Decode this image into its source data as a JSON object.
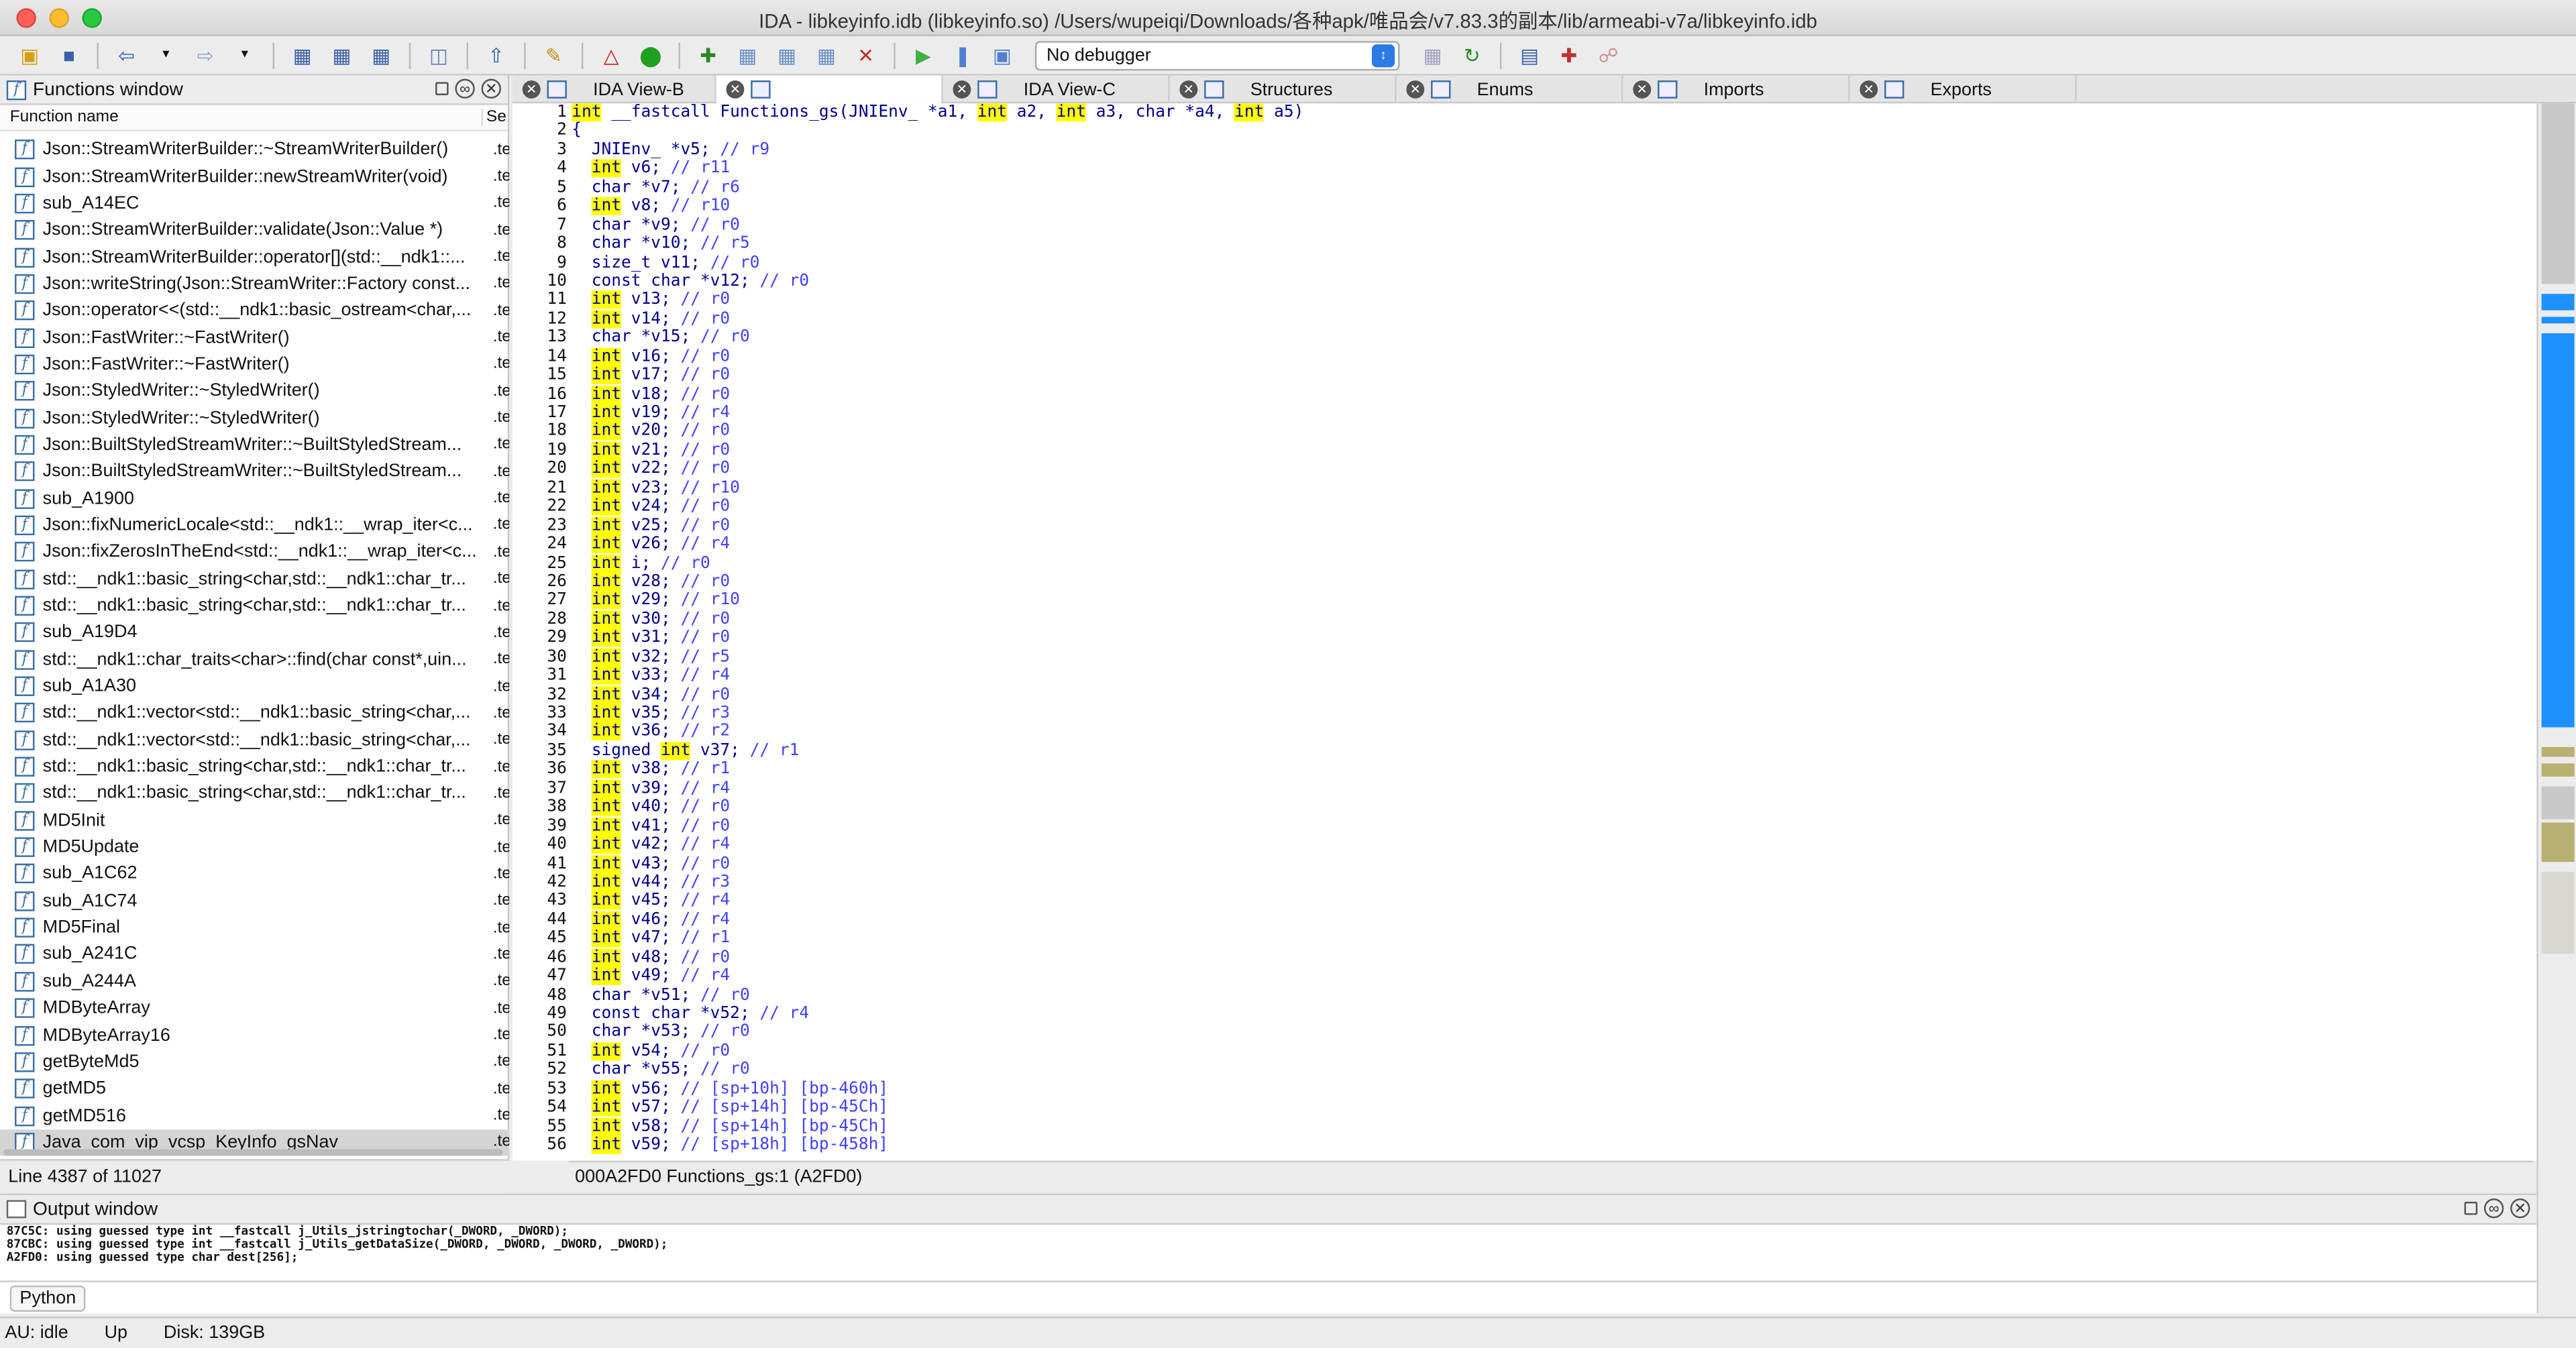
{
  "window": {
    "title": "IDA - libkeyinfo.idb (libkeyinfo.so) /Users/wupeiqi/Downloads/各种apk/唯品会/v7.83.3的副本/lib/armeabi-v7a/libkeyinfo.idb"
  },
  "toolbar": {
    "debugger_select": "No debugger"
  },
  "functions_window": {
    "title": "Functions window",
    "col_name": "Function name",
    "col_segment": "Se",
    "status": "Line 4387 of 11027",
    "items": [
      {
        "name": "Json::StreamWriterBuilder::~StreamWriterBuilder()",
        "seg": ".te"
      },
      {
        "name": "Json::StreamWriterBuilder::newStreamWriter(void)",
        "seg": ".te"
      },
      {
        "name": "sub_A14EC",
        "seg": ".te"
      },
      {
        "name": "Json::StreamWriterBuilder::validate(Json::Value *)",
        "seg": ".te"
      },
      {
        "name": "Json::StreamWriterBuilder::operator[](std::__ndk1::...",
        "seg": ".te"
      },
      {
        "name": "Json::writeString(Json::StreamWriter::Factory const...",
        "seg": ".te"
      },
      {
        "name": "Json::operator<<(std::__ndk1::basic_ostream<char,...",
        "seg": ".te"
      },
      {
        "name": "Json::FastWriter::~FastWriter()",
        "seg": ".te"
      },
      {
        "name": "Json::FastWriter::~FastWriter()",
        "seg": ".te"
      },
      {
        "name": "Json::StyledWriter::~StyledWriter()",
        "seg": ".te"
      },
      {
        "name": "Json::StyledWriter::~StyledWriter()",
        "seg": ".te"
      },
      {
        "name": "Json::BuiltStyledStreamWriter::~BuiltStyledStream...",
        "seg": ".te"
      },
      {
        "name": "Json::BuiltStyledStreamWriter::~BuiltStyledStream...",
        "seg": ".te"
      },
      {
        "name": "sub_A1900",
        "seg": ".te"
      },
      {
        "name": "Json::fixNumericLocale<std::__ndk1::__wrap_iter<c...",
        "seg": ".te"
      },
      {
        "name": "Json::fixZerosInTheEnd<std::__ndk1::__wrap_iter<c...",
        "seg": ".te"
      },
      {
        "name": "std::__ndk1::basic_string<char,std::__ndk1::char_tr...",
        "seg": ".te"
      },
      {
        "name": "std::__ndk1::basic_string<char,std::__ndk1::char_tr...",
        "seg": ".te"
      },
      {
        "name": "sub_A19D4",
        "seg": ".te"
      },
      {
        "name": "std::__ndk1::char_traits<char>::find(char const*,uin...",
        "seg": ".te"
      },
      {
        "name": "sub_A1A30",
        "seg": ".te"
      },
      {
        "name": "std::__ndk1::vector<std::__ndk1::basic_string<char,...",
        "seg": ".te"
      },
      {
        "name": "std::__ndk1::vector<std::__ndk1::basic_string<char,...",
        "seg": ".te"
      },
      {
        "name": "std::__ndk1::basic_string<char,std::__ndk1::char_tr...",
        "seg": ".te"
      },
      {
        "name": "std::__ndk1::basic_string<char,std::__ndk1::char_tr...",
        "seg": ".te"
      },
      {
        "name": "MD5Init",
        "seg": ".te"
      },
      {
        "name": "MD5Update",
        "seg": ".te"
      },
      {
        "name": "sub_A1C62",
        "seg": ".te"
      },
      {
        "name": "sub_A1C74",
        "seg": ".te"
      },
      {
        "name": "MD5Final",
        "seg": ".te"
      },
      {
        "name": "sub_A241C",
        "seg": ".te"
      },
      {
        "name": "sub_A244A",
        "seg": ".te"
      },
      {
        "name": "MDByteArray",
        "seg": ".te"
      },
      {
        "name": "MDByteArray16",
        "seg": ".te"
      },
      {
        "name": "getByteMd5",
        "seg": ".te"
      },
      {
        "name": "getMD5",
        "seg": ".te"
      },
      {
        "name": "getMD516",
        "seg": ".te"
      },
      {
        "name": "Java_com_vip_vcsp_KeyInfo_gsNav",
        "seg": ".te",
        "selected": true
      }
    ]
  },
  "tabs": [
    {
      "label": "IDA View-B",
      "width": 124
    },
    {
      "label": "",
      "width": 138,
      "active": true
    },
    {
      "label": "IDA View-C",
      "width": 138
    },
    {
      "label": "Structures",
      "width": 138
    },
    {
      "label": "Enums",
      "width": 138
    },
    {
      "label": "Imports",
      "width": 138
    },
    {
      "label": "Exports",
      "width": 138
    }
  ],
  "code": {
    "lines": [
      [
        [
          "hl",
          "int"
        ],
        [
          "t",
          " __fastcall Functions_gs(JNIEnv_ *a1, "
        ],
        [
          "hl",
          "int"
        ],
        [
          "t",
          " a2, "
        ],
        [
          "hl",
          "int"
        ],
        [
          "t",
          " a3, char *a4, "
        ],
        [
          "hl",
          "int"
        ],
        [
          "t",
          " a5)"
        ]
      ],
      [
        [
          "t",
          "{"
        ]
      ],
      [
        [
          "t",
          "  JNIEnv_ *v5; "
        ],
        [
          "c",
          "// r9"
        ]
      ],
      [
        [
          "t",
          "  "
        ],
        [
          "hl",
          "int"
        ],
        [
          "t",
          " v6; "
        ],
        [
          "c",
          "// r11"
        ]
      ],
      [
        [
          "t",
          "  char *v7; "
        ],
        [
          "c",
          "// r6"
        ]
      ],
      [
        [
          "t",
          "  "
        ],
        [
          "hl",
          "int"
        ],
        [
          "t",
          " v8; "
        ],
        [
          "c",
          "// r10"
        ]
      ],
      [
        [
          "t",
          "  char *v9; "
        ],
        [
          "c",
          "// r0"
        ]
      ],
      [
        [
          "t",
          "  char *v10; "
        ],
        [
          "c",
          "// r5"
        ]
      ],
      [
        [
          "t",
          "  size_t v11; "
        ],
        [
          "c",
          "// r0"
        ]
      ],
      [
        [
          "t",
          "  const char *v12; "
        ],
        [
          "c",
          "// r0"
        ]
      ],
      [
        [
          "t",
          "  "
        ],
        [
          "hl",
          "int"
        ],
        [
          "t",
          " v13; "
        ],
        [
          "c",
          "// r0"
        ]
      ],
      [
        [
          "t",
          "  "
        ],
        [
          "hl",
          "int"
        ],
        [
          "t",
          " v14; "
        ],
        [
          "c",
          "// r0"
        ]
      ],
      [
        [
          "t",
          "  char *v15; "
        ],
        [
          "c",
          "// r0"
        ]
      ],
      [
        [
          "t",
          "  "
        ],
        [
          "hl",
          "int"
        ],
        [
          "t",
          " v16; "
        ],
        [
          "c",
          "// r0"
        ]
      ],
      [
        [
          "t",
          "  "
        ],
        [
          "hl",
          "int"
        ],
        [
          "t",
          " v17; "
        ],
        [
          "c",
          "// r0"
        ]
      ],
      [
        [
          "t",
          "  "
        ],
        [
          "hl",
          "int"
        ],
        [
          "t",
          " v18; "
        ],
        [
          "c",
          "// r0"
        ]
      ],
      [
        [
          "t",
          "  "
        ],
        [
          "hl",
          "int"
        ],
        [
          "t",
          " v19; "
        ],
        [
          "c",
          "// r4"
        ]
      ],
      [
        [
          "t",
          "  "
        ],
        [
          "hl",
          "int"
        ],
        [
          "t",
          " v20; "
        ],
        [
          "c",
          "// r0"
        ]
      ],
      [
        [
          "t",
          "  "
        ],
        [
          "hl",
          "int"
        ],
        [
          "t",
          " v21; "
        ],
        [
          "c",
          "// r0"
        ]
      ],
      [
        [
          "t",
          "  "
        ],
        [
          "hl",
          "int"
        ],
        [
          "t",
          " v22; "
        ],
        [
          "c",
          "// r0"
        ]
      ],
      [
        [
          "t",
          "  "
        ],
        [
          "hl",
          "int"
        ],
        [
          "t",
          " v23; "
        ],
        [
          "c",
          "// r10"
        ]
      ],
      [
        [
          "t",
          "  "
        ],
        [
          "hl",
          "int"
        ],
        [
          "t",
          " v24; "
        ],
        [
          "c",
          "// r0"
        ]
      ],
      [
        [
          "t",
          "  "
        ],
        [
          "hl",
          "int"
        ],
        [
          "t",
          " v25; "
        ],
        [
          "c",
          "// r0"
        ]
      ],
      [
        [
          "t",
          "  "
        ],
        [
          "hl",
          "int"
        ],
        [
          "t",
          " v26; "
        ],
        [
          "c",
          "// r4"
        ]
      ],
      [
        [
          "t",
          "  "
        ],
        [
          "hl",
          "int"
        ],
        [
          "t",
          " i; "
        ],
        [
          "c",
          "// r0"
        ]
      ],
      [
        [
          "t",
          "  "
        ],
        [
          "hl",
          "int"
        ],
        [
          "t",
          " v28; "
        ],
        [
          "c",
          "// r0"
        ]
      ],
      [
        [
          "t",
          "  "
        ],
        [
          "hl",
          "int"
        ],
        [
          "t",
          " v29; "
        ],
        [
          "c",
          "// r10"
        ]
      ],
      [
        [
          "t",
          "  "
        ],
        [
          "hl",
          "int"
        ],
        [
          "t",
          " v30; "
        ],
        [
          "c",
          "// r0"
        ]
      ],
      [
        [
          "t",
          "  "
        ],
        [
          "hl",
          "int"
        ],
        [
          "t",
          " v31; "
        ],
        [
          "c",
          "// r0"
        ]
      ],
      [
        [
          "t",
          "  "
        ],
        [
          "hl",
          "int"
        ],
        [
          "t",
          " v32; "
        ],
        [
          "c",
          "// r5"
        ]
      ],
      [
        [
          "t",
          "  "
        ],
        [
          "hl",
          "int"
        ],
        [
          "t",
          " v33; "
        ],
        [
          "c",
          "// r4"
        ]
      ],
      [
        [
          "t",
          "  "
        ],
        [
          "hl",
          "int"
        ],
        [
          "t",
          " v34; "
        ],
        [
          "c",
          "// r0"
        ]
      ],
      [
        [
          "t",
          "  "
        ],
        [
          "hl",
          "int"
        ],
        [
          "t",
          " v35; "
        ],
        [
          "c",
          "// r3"
        ]
      ],
      [
        [
          "t",
          "  "
        ],
        [
          "hl",
          "int"
        ],
        [
          "t",
          " v36; "
        ],
        [
          "c",
          "// r2"
        ]
      ],
      [
        [
          "t",
          "  signed "
        ],
        [
          "hl",
          "int"
        ],
        [
          "t",
          " v37; "
        ],
        [
          "c",
          "// r1"
        ]
      ],
      [
        [
          "t",
          "  "
        ],
        [
          "hl",
          "int"
        ],
        [
          "t",
          " v38; "
        ],
        [
          "c",
          "// r1"
        ]
      ],
      [
        [
          "t",
          "  "
        ],
        [
          "hl",
          "int"
        ],
        [
          "t",
          " v39; "
        ],
        [
          "c",
          "// r4"
        ]
      ],
      [
        [
          "t",
          "  "
        ],
        [
          "hl",
          "int"
        ],
        [
          "t",
          " v40; "
        ],
        [
          "c",
          "// r0"
        ]
      ],
      [
        [
          "t",
          "  "
        ],
        [
          "hl",
          "int"
        ],
        [
          "t",
          " v41; "
        ],
        [
          "c",
          "// r0"
        ]
      ],
      [
        [
          "t",
          "  "
        ],
        [
          "hl",
          "int"
        ],
        [
          "t",
          " v42; "
        ],
        [
          "c",
          "// r4"
        ]
      ],
      [
        [
          "t",
          "  "
        ],
        [
          "hl",
          "int"
        ],
        [
          "t",
          " v43; "
        ],
        [
          "c",
          "// r0"
        ]
      ],
      [
        [
          "t",
          "  "
        ],
        [
          "hl",
          "int"
        ],
        [
          "t",
          " v44; "
        ],
        [
          "c",
          "// r3"
        ]
      ],
      [
        [
          "t",
          "  "
        ],
        [
          "hl",
          "int"
        ],
        [
          "t",
          " v45; "
        ],
        [
          "c",
          "// r4"
        ]
      ],
      [
        [
          "t",
          "  "
        ],
        [
          "hl",
          "int"
        ],
        [
          "t",
          " v46; "
        ],
        [
          "c",
          "// r4"
        ]
      ],
      [
        [
          "t",
          "  "
        ],
        [
          "hl",
          "int"
        ],
        [
          "t",
          " v47; "
        ],
        [
          "c",
          "// r1"
        ]
      ],
      [
        [
          "t",
          "  "
        ],
        [
          "hl",
          "int"
        ],
        [
          "t",
          " v48; "
        ],
        [
          "c",
          "// r0"
        ]
      ],
      [
        [
          "t",
          "  "
        ],
        [
          "hl",
          "int"
        ],
        [
          "t",
          " v49; "
        ],
        [
          "c",
          "// r4"
        ]
      ],
      [
        [
          "t",
          "  char *v51; "
        ],
        [
          "c",
          "// r0"
        ]
      ],
      [
        [
          "t",
          "  const char *v52; "
        ],
        [
          "c",
          "// r4"
        ]
      ],
      [
        [
          "t",
          "  char *v53; "
        ],
        [
          "c",
          "// r0"
        ]
      ],
      [
        [
          "t",
          "  "
        ],
        [
          "hl",
          "int"
        ],
        [
          "t",
          " v54; "
        ],
        [
          "c",
          "// r0"
        ]
      ],
      [
        [
          "t",
          "  char *v55; "
        ],
        [
          "c",
          "// r0"
        ]
      ],
      [
        [
          "t",
          "  "
        ],
        [
          "hl",
          "int"
        ],
        [
          "t",
          " v56; "
        ],
        [
          "c",
          "// [sp+10h] [bp-460h]"
        ]
      ],
      [
        [
          "t",
          "  "
        ],
        [
          "hl",
          "int"
        ],
        [
          "t",
          " v57; "
        ],
        [
          "c",
          "// [sp+14h] [bp-45Ch]"
        ]
      ],
      [
        [
          "t",
          "  "
        ],
        [
          "hl",
          "int"
        ],
        [
          "t",
          " v58; "
        ],
        [
          "c",
          "// [sp+14h] [bp-45Ch]"
        ]
      ],
      [
        [
          "t",
          "  "
        ],
        [
          "hl",
          "int"
        ],
        [
          "t",
          " v59; "
        ],
        [
          "c",
          "// [sp+18h] [bp-458h]"
        ]
      ]
    ],
    "status": "000A2FD0 Functions_gs:1 (A2FD0)"
  },
  "output_window": {
    "title": "Output window",
    "lines": [
      "87C5C: using guessed type int __fastcall j_Utils_jstringtochar(_DWORD, _DWORD);",
      "87CBC: using guessed type int __fastcall j_Utils_getDataSize(_DWORD, _DWORD, _DWORD, _DWORD);",
      "A2FD0: using guessed type char dest[256];"
    ],
    "python_label": "Python"
  },
  "statusbar": {
    "au": "AU:  idle",
    "dir": "Up",
    "disk": "Disk: 139GB"
  },
  "colors": {
    "highlight": "#ffff00",
    "keyword": "#00008b",
    "comment": "#4040ff",
    "nav_blue": "#1e90ff"
  }
}
